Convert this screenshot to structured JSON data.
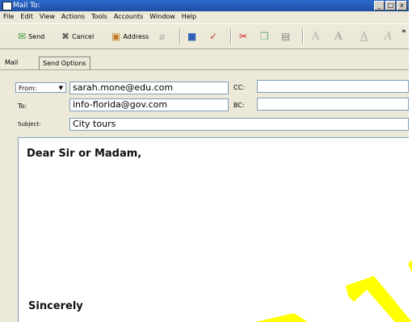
{
  "window": {
    "title": "Mail To:"
  },
  "window_buttons": [
    "_",
    "□",
    "x"
  ],
  "menu": [
    "File",
    "Edit",
    "View",
    "Actions",
    "Tools",
    "Accounts",
    "Window",
    "Help"
  ],
  "toolbar": {
    "send_label": "Send",
    "cancel_label": "Cancel",
    "address_label": "Address",
    "overflow": "»",
    "font_glyphs": [
      "A",
      "A",
      "A",
      "A"
    ]
  },
  "tabs": [
    "Mail",
    "Send Options"
  ],
  "fields": {
    "from_label": "From:",
    "from_value": "sarah.mone@edu.com",
    "to_label": "To:",
    "to_value": "info-florida@gov.com",
    "subject_label": "Subject:",
    "subject_value": "City tours",
    "cc_label": "CC:",
    "cc_value": "",
    "bc_label": "BC:",
    "bc_value": ""
  },
  "message": {
    "greeting": "Dear Sir or Madam,",
    "closing": "Sincerely"
  },
  "colors": {
    "titlebar": "#1f4fa6",
    "window_bg": "#ece9d8",
    "annotation": "#ffff00"
  }
}
